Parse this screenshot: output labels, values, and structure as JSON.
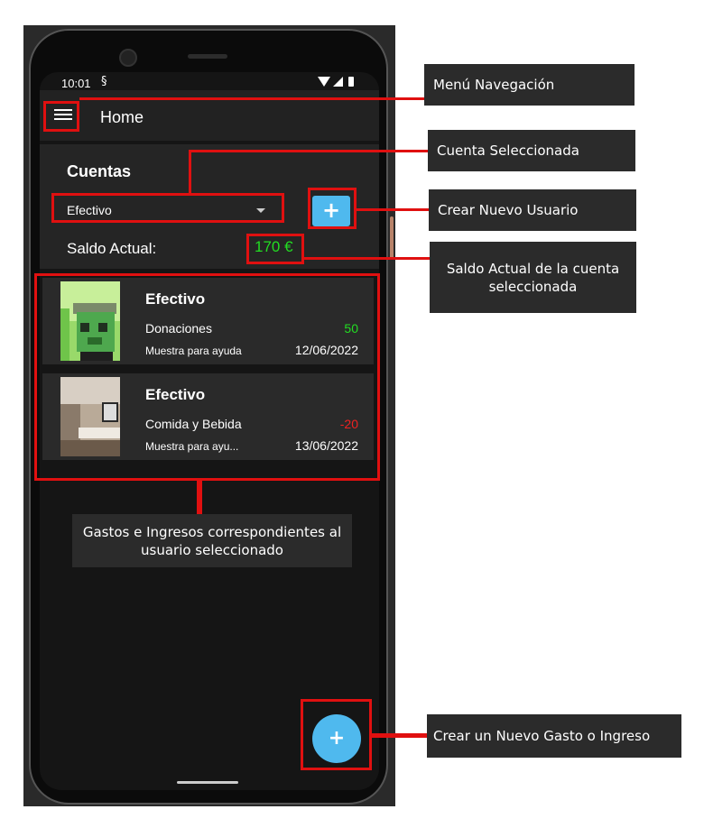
{
  "status_bar": {
    "time": "10:01",
    "sync_icon": "sync-icon"
  },
  "app_bar": {
    "title": "Home",
    "menu_icon": "hamburger-menu-icon"
  },
  "accounts": {
    "title": "Cuentas",
    "selected_account": "Efectivo",
    "add_button": "+",
    "balance_label": "Saldo Actual:",
    "balance_value": "170 €",
    "balance_color": "#22dd22"
  },
  "transactions": [
    {
      "name": "Efectivo",
      "category": "Donaciones",
      "amount": "50",
      "amount_color": "#22dd22",
      "description": "Muestra para ayuda",
      "date": "12/06/2022"
    },
    {
      "name": "Efectivo",
      "category": "Comida y Bebida",
      "amount": "-20",
      "amount_color": "#ee2222",
      "description": "Muestra  para ayu...",
      "date": "13/06/2022"
    }
  ],
  "fab": {
    "label": "+"
  },
  "annotations": {
    "menu": "Menú Navegación",
    "selected_account": "Cuenta Seleccionada",
    "new_user": "Crear Nuevo Usuario",
    "balance": "Saldo Actual de la cuenta seleccionada",
    "transactions": "Gastos e Ingresos correspondientes al usuario seleccionado",
    "new_entry": "Crear un Nuevo Gasto o Ingreso"
  },
  "colors": {
    "accent": "#4fb9ee",
    "highlight": "#e01010",
    "income": "#22dd22",
    "expense": "#ee2222"
  }
}
